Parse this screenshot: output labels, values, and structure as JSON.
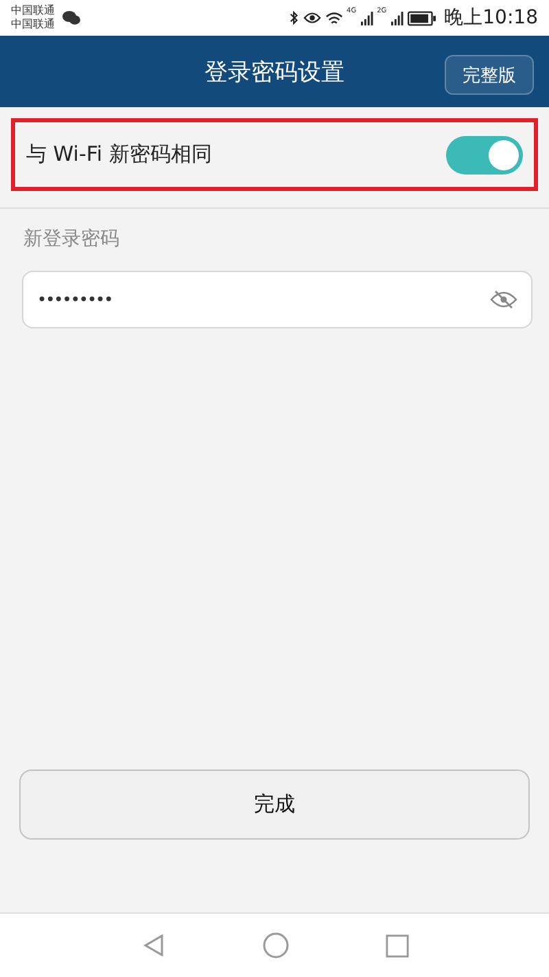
{
  "status_bar": {
    "carriers": [
      "中国联通",
      "中国联通"
    ],
    "network_labels": [
      "4G",
      "2G"
    ],
    "time": "晚上10:18"
  },
  "header": {
    "title": "登录密码设置",
    "action": "完整版"
  },
  "sync_toggle": {
    "label": "与 Wi-Fi 新密码相同",
    "on": true,
    "highlighted": true
  },
  "password": {
    "label": "新登录密码",
    "value": "•••••••••",
    "visible": false
  },
  "done_button": "完成"
}
